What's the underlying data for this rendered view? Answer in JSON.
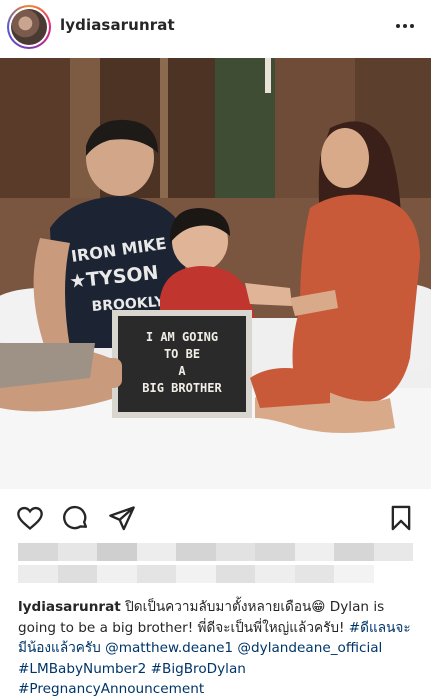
{
  "post": {
    "username": "lydiasarunrat"
  },
  "photo": {
    "shirt_line1": "IRON MIKE",
    "shirt_line2": "★TYSON",
    "shirt_line3": "BROOKLY",
    "board_line1": "I AM GOING",
    "board_line2": "TO BE",
    "board_line3": "A",
    "board_line4": "BIG BROTHER"
  },
  "icons": {
    "more": "more-options-icon",
    "like": "heart-icon",
    "comment": "comment-icon",
    "share": "paper-plane-icon",
    "save": "bookmark-icon"
  },
  "caption": {
    "username": "lydiasarunrat",
    "text_part1": " ปิดเป็นความลับมาตั้งหลายเดือน😁 Dylan is going to be a big brother! พี่ดีจะเป็นพี่ใหญ่แล้วครับ! ",
    "hashtag1": "#ดีแลนจะมีน้องแล้วครับ",
    "mention1": "@matthew.deane1",
    "mention2": "@dylandeane_official",
    "hashtag2": "#LMBabyNumber2",
    "hashtag3": "#BigBroDylan",
    "hashtag4": "#PregnancyAnnouncement"
  }
}
